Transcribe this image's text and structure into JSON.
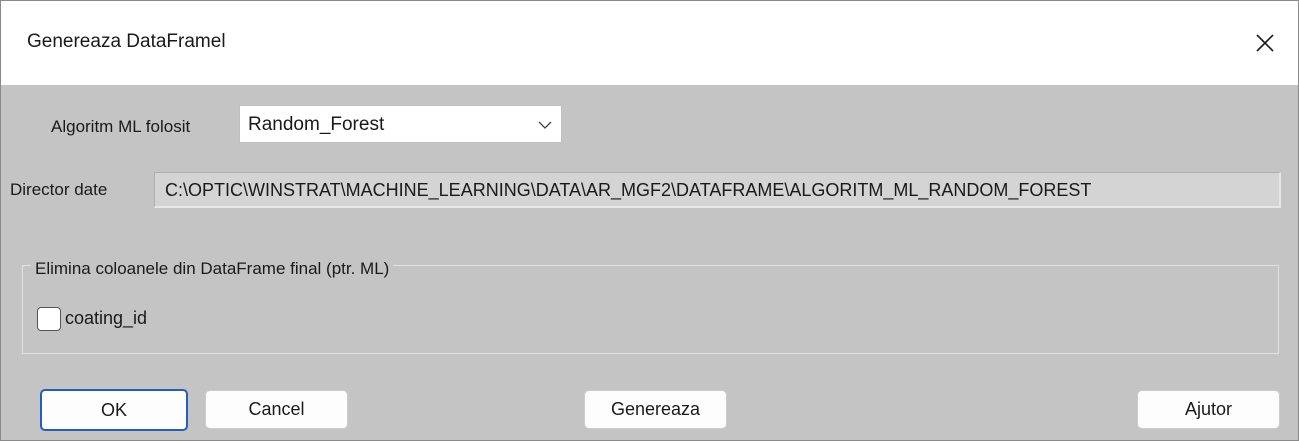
{
  "window": {
    "title": "Genereaza DataFramel",
    "close_icon": "close-icon"
  },
  "form": {
    "algorithm_label": "Algoritm ML folosit",
    "algorithm_value": "Random_Forest",
    "dropdown_icon": "chevron-down-icon",
    "directory_label": "Director date",
    "directory_value": "C:\\OPTIC\\WINSTRAT\\MACHINE_LEARNING\\DATA\\AR_MGF2\\DATAFRAME\\ALGORITM_ML_RANDOM_FOREST"
  },
  "group": {
    "title": "Elimina coloanele din DataFrame final (ptr. ML)",
    "checkbox_label": "coating_id",
    "checkbox_checked": false
  },
  "buttons": {
    "ok": "OK",
    "cancel": "Cancel",
    "generate": "Genereaza",
    "help": "Ajutor"
  },
  "colors": {
    "dialog_background": "#c4c4c4",
    "focus_border": "#1f5fbf"
  }
}
